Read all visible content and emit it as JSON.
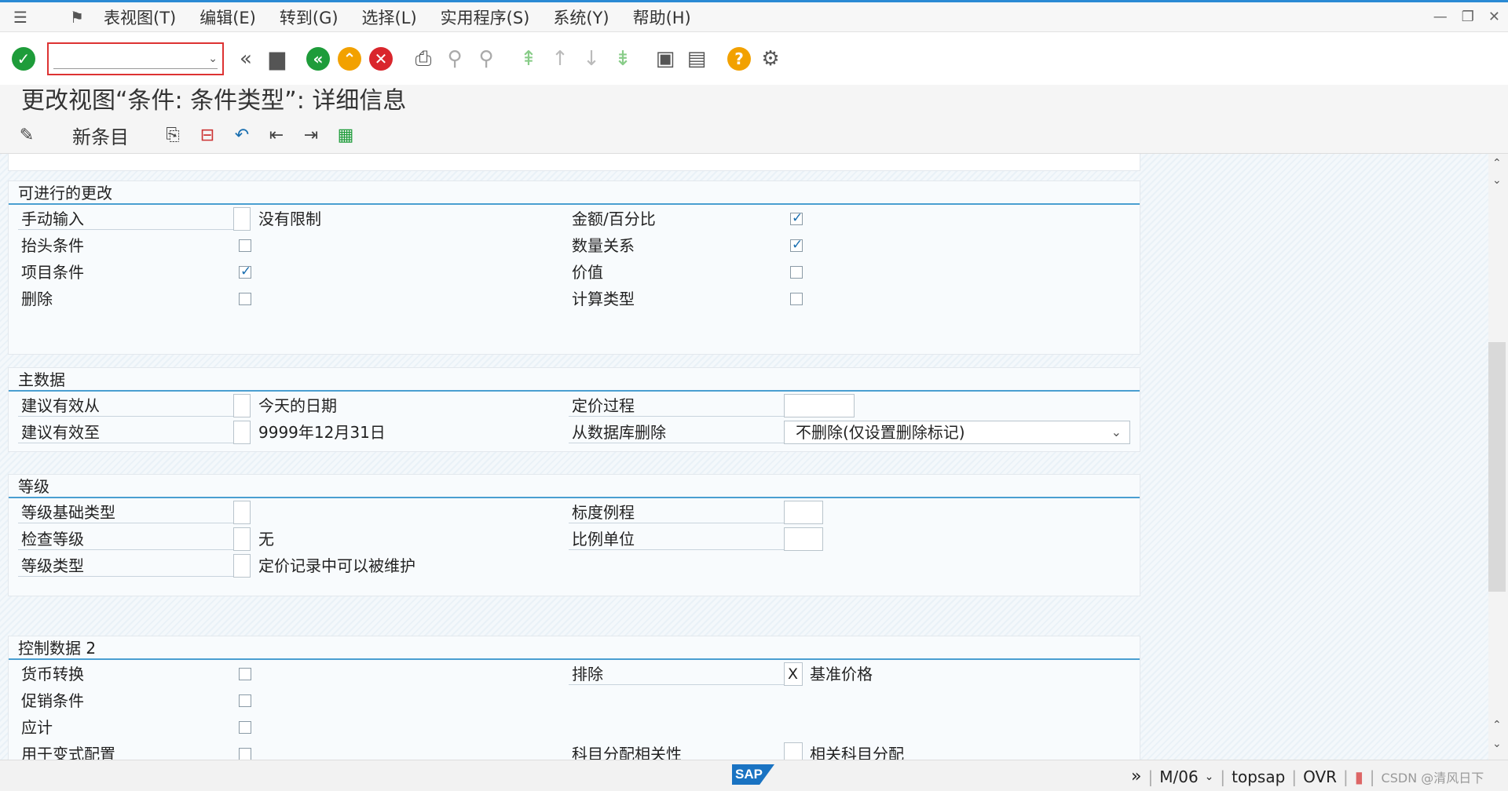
{
  "menu": {
    "items": [
      "表视图(T)",
      "编辑(E)",
      "转到(G)",
      "选择(L)",
      "实用程序(S)",
      "系统(Y)",
      "帮助(H)"
    ]
  },
  "title": "更改视图“条件: 条件类型”: 详细信息",
  "app_toolbar": {
    "new_entries": "新条目"
  },
  "groups": {
    "changes": {
      "title": "可进行的更改",
      "manual_entry": {
        "label": "手动输入",
        "value": "没有限制"
      },
      "header_condition": {
        "label": "抬头条件",
        "checked": false
      },
      "item_condition": {
        "label": "项目条件",
        "checked": true
      },
      "delete": {
        "label": "删除",
        "checked": false
      },
      "amount_percent": {
        "label": "金额/百分比",
        "checked": true
      },
      "qty_relation": {
        "label": "数量关系",
        "checked": true
      },
      "value": {
        "label": "价值",
        "checked": false
      },
      "calc_type": {
        "label": "计算类型",
        "checked": false
      }
    },
    "master_data": {
      "title": "主数据",
      "valid_from": {
        "label": "建议有效从",
        "value": "今天的日期"
      },
      "valid_to": {
        "label": "建议有效至",
        "value": "9999年12月31日"
      },
      "pricing_proc": {
        "label": "定价过程",
        "value": ""
      },
      "delete_db": {
        "label": "从数据库删除",
        "value": "不删除(仅设置删除标记)"
      }
    },
    "scales": {
      "title": "等级",
      "scale_base": {
        "label": "等级基础类型",
        "value": ""
      },
      "check_scale": {
        "label": "检查等级",
        "value": "无"
      },
      "scale_type": {
        "label": "等级类型",
        "value": "定价记录中可以被维护"
      },
      "scale_formula": {
        "label": "标度例程",
        "value": ""
      },
      "scale_unit": {
        "label": "比例单位",
        "value": ""
      }
    },
    "control2": {
      "title": "控制数据 2",
      "currency_conv": {
        "label": "货币转换",
        "checked": false
      },
      "promo_cond": {
        "label": "促销条件",
        "checked": false
      },
      "accrual": {
        "label": "应计",
        "checked": false
      },
      "variant_config": {
        "label": "用于变式配置",
        "checked": false
      },
      "exclusion": {
        "label": "排除",
        "value": "X",
        "desc": "基准价格"
      },
      "acct_assign": {
        "label": "科目分配相关性",
        "value": "",
        "desc": "相关科目分配"
      }
    }
  },
  "status": {
    "mode": "M/06",
    "server": "topsap",
    "ovr": "OVR",
    "watermark": "CSDN @清风日下"
  },
  "colors": {
    "accent": "#4a9fd1",
    "check_green": "#1e9c3a",
    "exit_yellow": "#f2a100",
    "cancel_red": "#d9262c"
  }
}
